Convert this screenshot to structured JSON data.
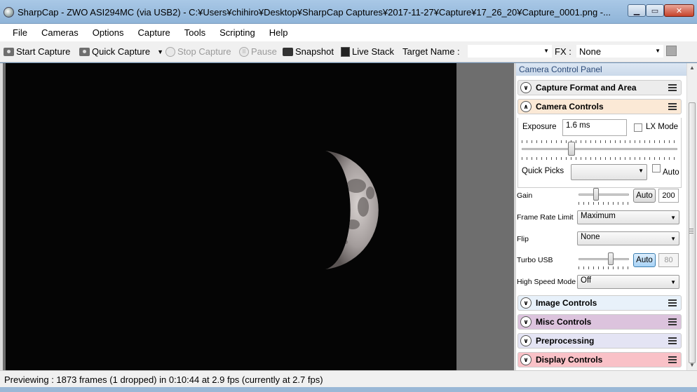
{
  "window": {
    "title": "SharpCap - ZWO ASI294MC (via USB2) - C:¥Users¥chihiro¥Desktop¥SharpCap Captures¥2017-11-27¥Capture¥17_26_20¥Capture_0001.png -..."
  },
  "menu": [
    "File",
    "Cameras",
    "Options",
    "Capture",
    "Tools",
    "Scripting",
    "Help"
  ],
  "toolbar": {
    "start_capture": "Start Capture",
    "quick_capture": "Quick Capture",
    "stop_capture": "Stop Capture",
    "pause": "Pause",
    "snapshot": "Snapshot",
    "live_stack": "Live Stack",
    "target_name_label": "Target Name :",
    "target_name_value": "",
    "fx_label": "FX :",
    "fx_value": "None"
  },
  "panel": {
    "title": "Camera Control Panel",
    "sections": {
      "capture_format": "Capture Format and Area",
      "camera_controls": "Camera Controls",
      "image_controls": "Image Controls",
      "misc_controls": "Misc Controls",
      "preprocessing": "Preprocessing",
      "display_controls": "Display Controls"
    },
    "camera": {
      "exposure_label": "Exposure",
      "exposure_value": "1.6 ms",
      "lx_mode_label": "LX Mode",
      "lx_mode_checked": false,
      "exposure_slider_fraction": 0.31,
      "quick_picks_label": "Quick Picks",
      "quick_picks_value": "",
      "auto_label": "Auto",
      "auto_checked": false,
      "gain_label": "Gain",
      "gain_auto": "Auto",
      "gain_value": "200",
      "gain_slider_fraction": 0.33,
      "frame_rate_label": "Frame Rate Limit",
      "frame_rate_value": "Maximum",
      "flip_label": "Flip",
      "flip_value": "None",
      "turbo_usb_label": "Turbo USB",
      "turbo_usb_auto": "Auto",
      "turbo_usb_value": "80",
      "turbo_slider_fraction": 0.66,
      "high_speed_label": "High Speed Mode",
      "high_speed_value": "Off"
    }
  },
  "status": {
    "text": "Previewing : 1873 frames (1 dropped) in 0:10:44 at 2.9 fps  (currently at 2.7 fps)"
  },
  "colors": {
    "capture_format_bg": "#ececec",
    "camera_controls_bg": "#fbe9d6",
    "image_controls_bg": "#e8f1fa",
    "misc_controls_bg": "#dcc3dd",
    "preprocessing_bg": "#e4e4f4",
    "display_controls_bg": "#f9c1c7"
  }
}
